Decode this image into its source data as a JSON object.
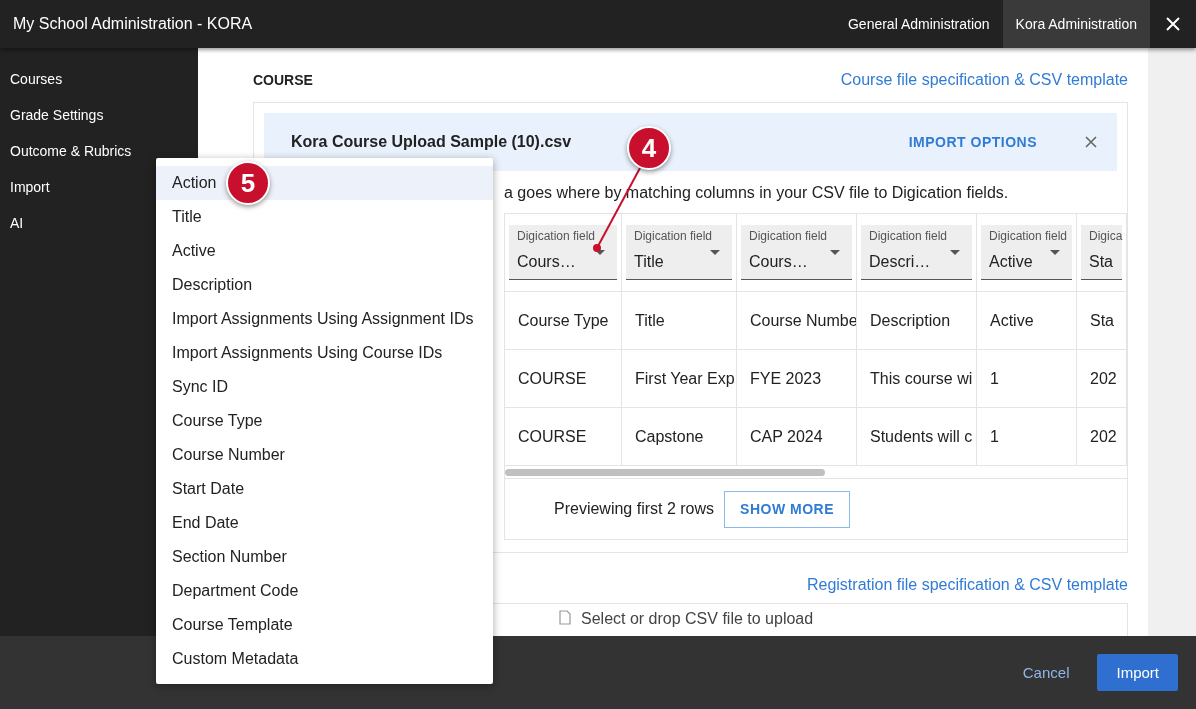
{
  "window": {
    "title": "My School Administration - KORA"
  },
  "tabs": [
    {
      "label": "General Administration",
      "selected": false
    },
    {
      "label": "Kora Administration",
      "selected": true
    }
  ],
  "sidebar": {
    "items": [
      "Courses",
      "Grade Settings",
      "Outcome & Rubrics",
      "Import",
      "AI"
    ]
  },
  "course_section": {
    "heading": "COURSE",
    "spec_link": "Course file specification & CSV template",
    "file": {
      "name": "Kora Course Upload Sample (10).csv",
      "options_button": "IMPORT OPTIONS"
    },
    "description": "a goes where by matching columns in your CSV file to Digication fields.",
    "mapping_columns": [
      {
        "label": "Digication field",
        "value": "Cours…"
      },
      {
        "label": "Digication field",
        "value": "Title"
      },
      {
        "label": "Digication field",
        "value": "Cours…"
      },
      {
        "label": "Digication field",
        "value": "Descri…"
      },
      {
        "label": "Digication field",
        "value": "Active"
      },
      {
        "label": "Digica",
        "value": "Sta"
      }
    ],
    "rows": [
      [
        "Course Type",
        "Title",
        "Course Numbe",
        "Description",
        "Active",
        "Sta"
      ],
      [
        "COURSE",
        "First Year Exp",
        "FYE 2023",
        "This course wi",
        "1",
        "202"
      ],
      [
        "COURSE",
        "Capstone",
        "CAP 2024",
        "Students will c",
        "1",
        "202"
      ]
    ],
    "preview_text": "Previewing first 2 rows",
    "show_more_button": "SHOW MORE"
  },
  "registration_section": {
    "spec_link": "Registration file specification & CSV template",
    "upload_hint": "Select or drop CSV file to upload"
  },
  "footer": {
    "cancel_button": "Cancel",
    "import_button": "Import"
  },
  "field_menu": {
    "items": [
      {
        "label": "Action",
        "selected": true
      },
      {
        "label": "Title",
        "selected": false
      },
      {
        "label": "Active",
        "selected": false
      },
      {
        "label": "Description",
        "selected": false
      },
      {
        "label": "Import Assignments Using Assignment IDs",
        "selected": false
      },
      {
        "label": "Import Assignments Using Course IDs",
        "selected": false
      },
      {
        "label": "Sync ID",
        "selected": false
      },
      {
        "label": "Course Type",
        "selected": false
      },
      {
        "label": "Course Number",
        "selected": false
      },
      {
        "label": "Start Date",
        "selected": false
      },
      {
        "label": "End Date",
        "selected": false
      },
      {
        "label": "Section Number",
        "selected": false
      },
      {
        "label": "Department Code",
        "selected": false
      },
      {
        "label": "Course Template",
        "selected": false
      },
      {
        "label": "Custom Metadata",
        "selected": false
      }
    ]
  },
  "step_badges": [
    "5",
    "4"
  ]
}
